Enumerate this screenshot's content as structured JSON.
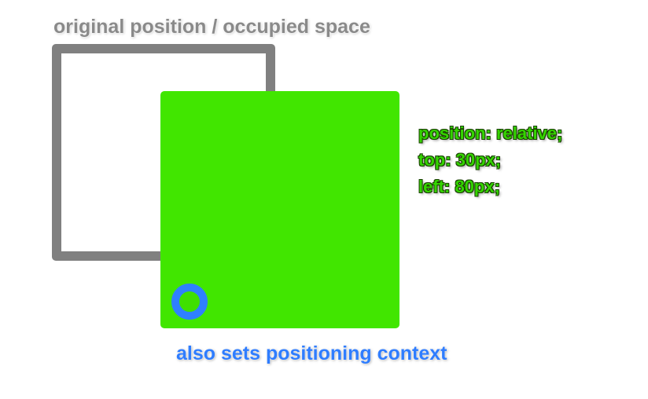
{
  "labels": {
    "original_position": "original position / occupied space",
    "positioning_context": "also sets positioning context"
  },
  "code": {
    "line1": "position: relative;",
    "line2": "top: 30px;",
    "line3": "left: 80px;"
  },
  "colors": {
    "outline": "#808080",
    "green_box": "#41e600",
    "code_text": "#34d400",
    "ring": "#2f80ff",
    "context_label": "#2f7dff",
    "original_label": "#8a8a8a"
  }
}
